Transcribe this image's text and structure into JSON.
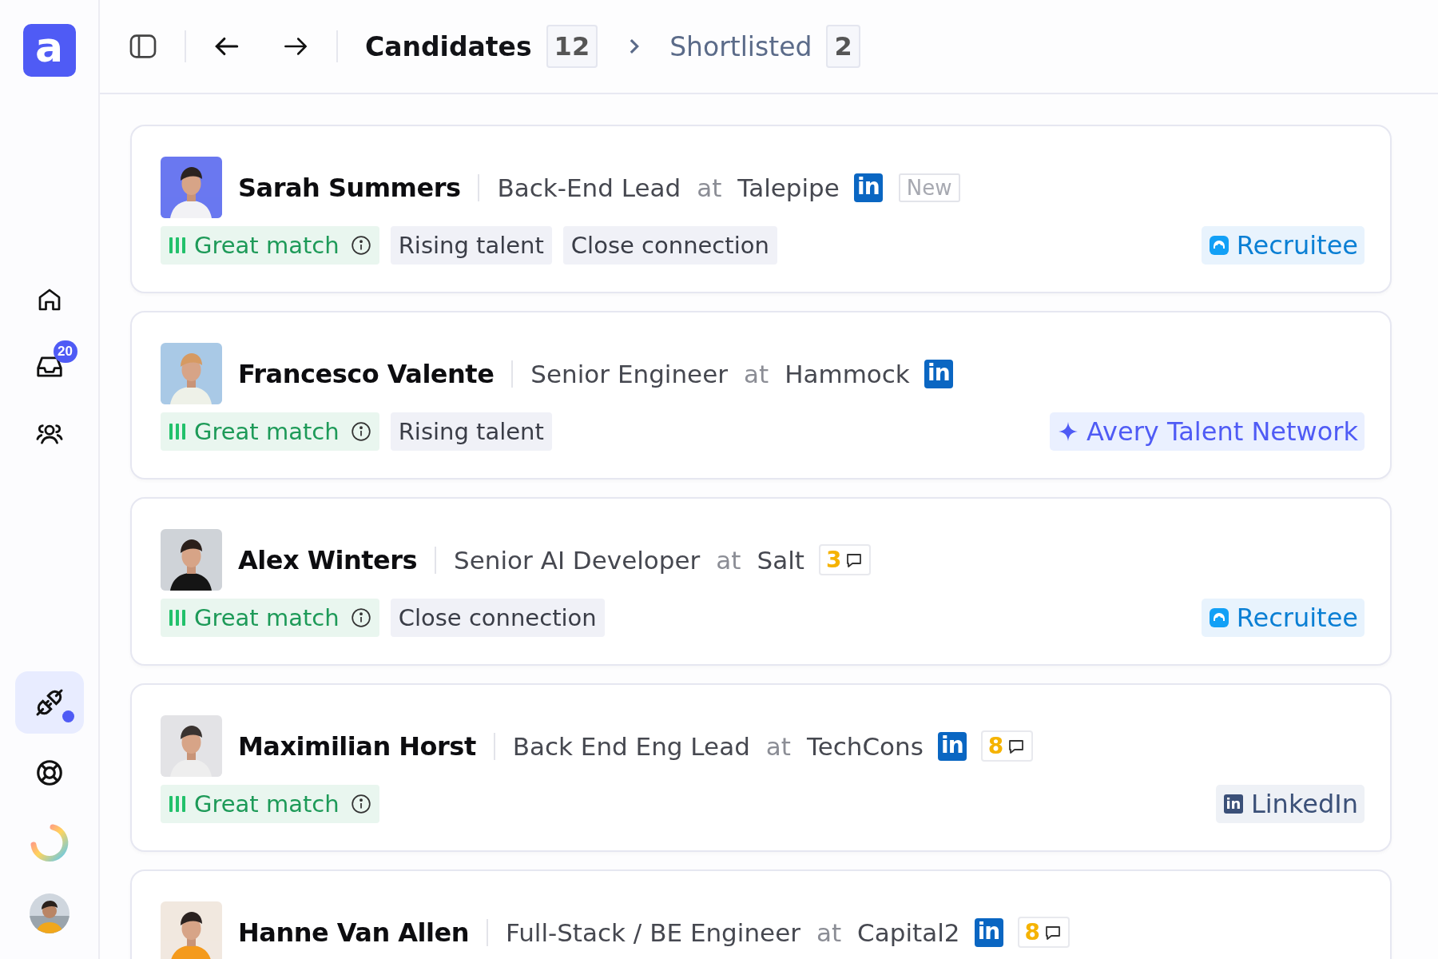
{
  "sidebar": {
    "logo": "a",
    "top_items": [
      {
        "kind": "home",
        "selected": false
      },
      {
        "kind": "inbox",
        "selected": false,
        "badge": "20"
      },
      {
        "kind": "people",
        "selected": false
      }
    ],
    "bottom_items": [
      {
        "kind": "plug",
        "selected": true,
        "dot": true
      },
      {
        "kind": "lifebuoy",
        "selected": false
      },
      {
        "kind": "progress-ring",
        "selected": false
      },
      {
        "kind": "avatar",
        "selected": false
      }
    ]
  },
  "top_bar": {
    "breadcrumbs": [
      {
        "label": "Candidates",
        "count": "12",
        "selected": true
      },
      {
        "label": "Shortlisted",
        "count": "2",
        "selected": false
      }
    ]
  },
  "candidates": [
    {
      "name": "Sarah Summers",
      "title": "Back-End Lead",
      "at": "at",
      "company": "Talepipe",
      "linkedin": "in",
      "new_badge": "New",
      "tags": [
        {
          "kind": "match",
          "label": "Great match"
        },
        {
          "kind": "plain",
          "label": "Rising talent"
        },
        {
          "kind": "plain",
          "label": "Close connection"
        }
      ],
      "source": {
        "kind": "recruitee",
        "label": "Recruitee"
      }
    },
    {
      "name": "Francesco Valente",
      "title": "Senior Engineer",
      "at": "at",
      "company": "Hammock",
      "linkedin": "in",
      "tags": [
        {
          "kind": "match",
          "label": "Great match"
        },
        {
          "kind": "plain",
          "label": "Rising talent"
        }
      ],
      "source": {
        "kind": "avery",
        "label": "Avery Talent Network"
      }
    },
    {
      "name": "Alex Winters",
      "title": "Senior AI Developer",
      "at": "at",
      "company": "Salt",
      "comments": "3",
      "tags": [
        {
          "kind": "match",
          "label": "Great match"
        },
        {
          "kind": "plain",
          "label": "Close connection"
        }
      ],
      "source": {
        "kind": "recruitee",
        "label": "Recruitee"
      }
    },
    {
      "name": "Maximilian Horst",
      "title": "Back End Eng Lead",
      "at": "at",
      "company": "TechCons",
      "linkedin": "in",
      "comments": "8",
      "tags": [
        {
          "kind": "match",
          "label": "Great match"
        }
      ],
      "source": {
        "kind": "linkedin",
        "label": "LinkedIn",
        "icon_text": "in"
      }
    },
    {
      "name": "Hanne Van Allen",
      "title": "Full-Stack / BE Engineer",
      "at": "at",
      "company": "Capital2",
      "linkedin": "in",
      "comments": "8"
    }
  ]
}
